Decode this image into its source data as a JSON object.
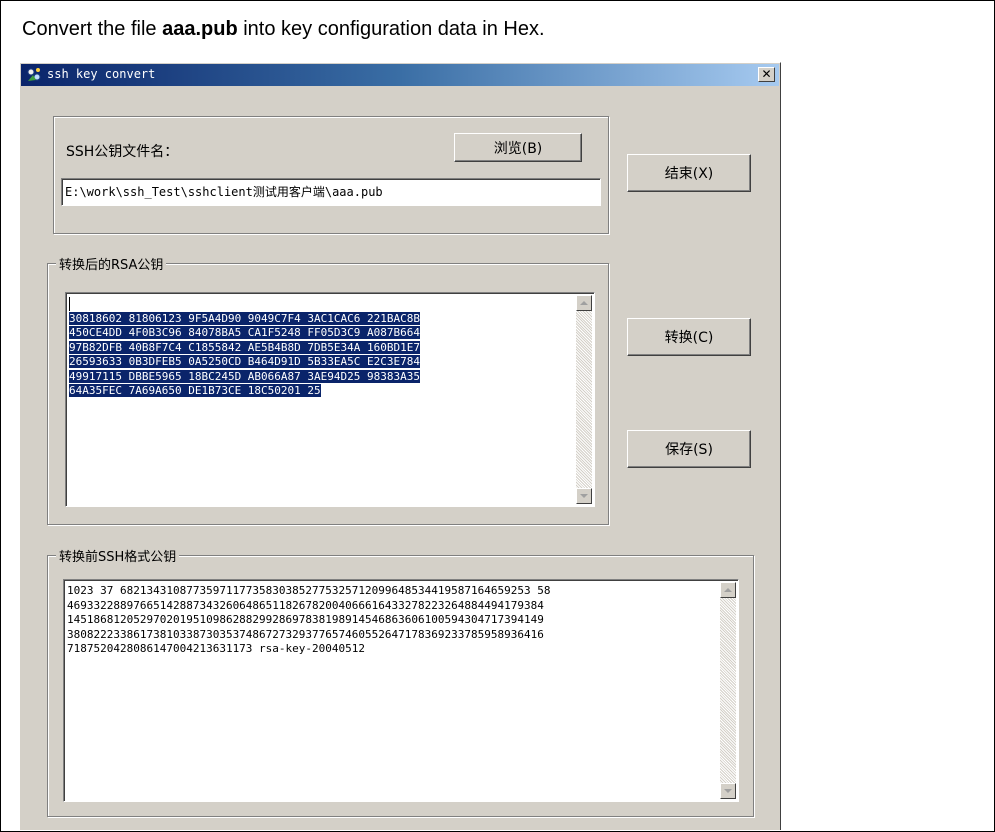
{
  "caption": {
    "prefix": "Convert the file ",
    "filename": "aaa.pub",
    "suffix": " into key configuration data in Hex."
  },
  "window": {
    "title": "ssh key convert",
    "close_label": "✕",
    "icon": "app-icon"
  },
  "file_group": {
    "label": "SSH公钥文件名：",
    "browse_label": "浏览(B)",
    "path_value": "E:\\work\\ssh_Test\\sshclient测试用客户端\\aaa.pub"
  },
  "buttons": {
    "end_label": "结束(X)",
    "convert_label": "转换(C)",
    "save_label": "保存(S)"
  },
  "rsa_group": {
    "title": "转换后的RSA公钥",
    "lines": [
      "30818602 81806123 9F5A4D90 9049C7F4 3AC1CAC6 221BAC8B",
      "450CE4DD 4F0B3C96 84078BA5 CA1F5248 FF05D3C9 A087B664",
      "97B82DFB 40B8F7C4 C1855842 AE5B4B8D 7DB5E34A 160BD1E7",
      "26593633 0B3DFEB5 0A5250CD B464D91D 5B33EA5C E2C3E784",
      "49917115 DBBE5965 18BC245D AB066A87 3AE94D25 98383A35",
      "64A35FEC 7A69A650 DE1B73CE 18C50201 25"
    ]
  },
  "ssh_group": {
    "title": "转换前SSH格式公钥",
    "lines": [
      "1023 37 68213431087735971177358303852775325712099648534419587164659253 58",
      "469332288976651428873432606486511826782004066616433278223264884494179384",
      "145186812052970201951098628829928697838198914546863606100594304717394149",
      "380822233861738103387303537486727329377657460552647178369233785958936416",
      "7187520428086147004213631173 rsa-key-20040512"
    ]
  }
}
